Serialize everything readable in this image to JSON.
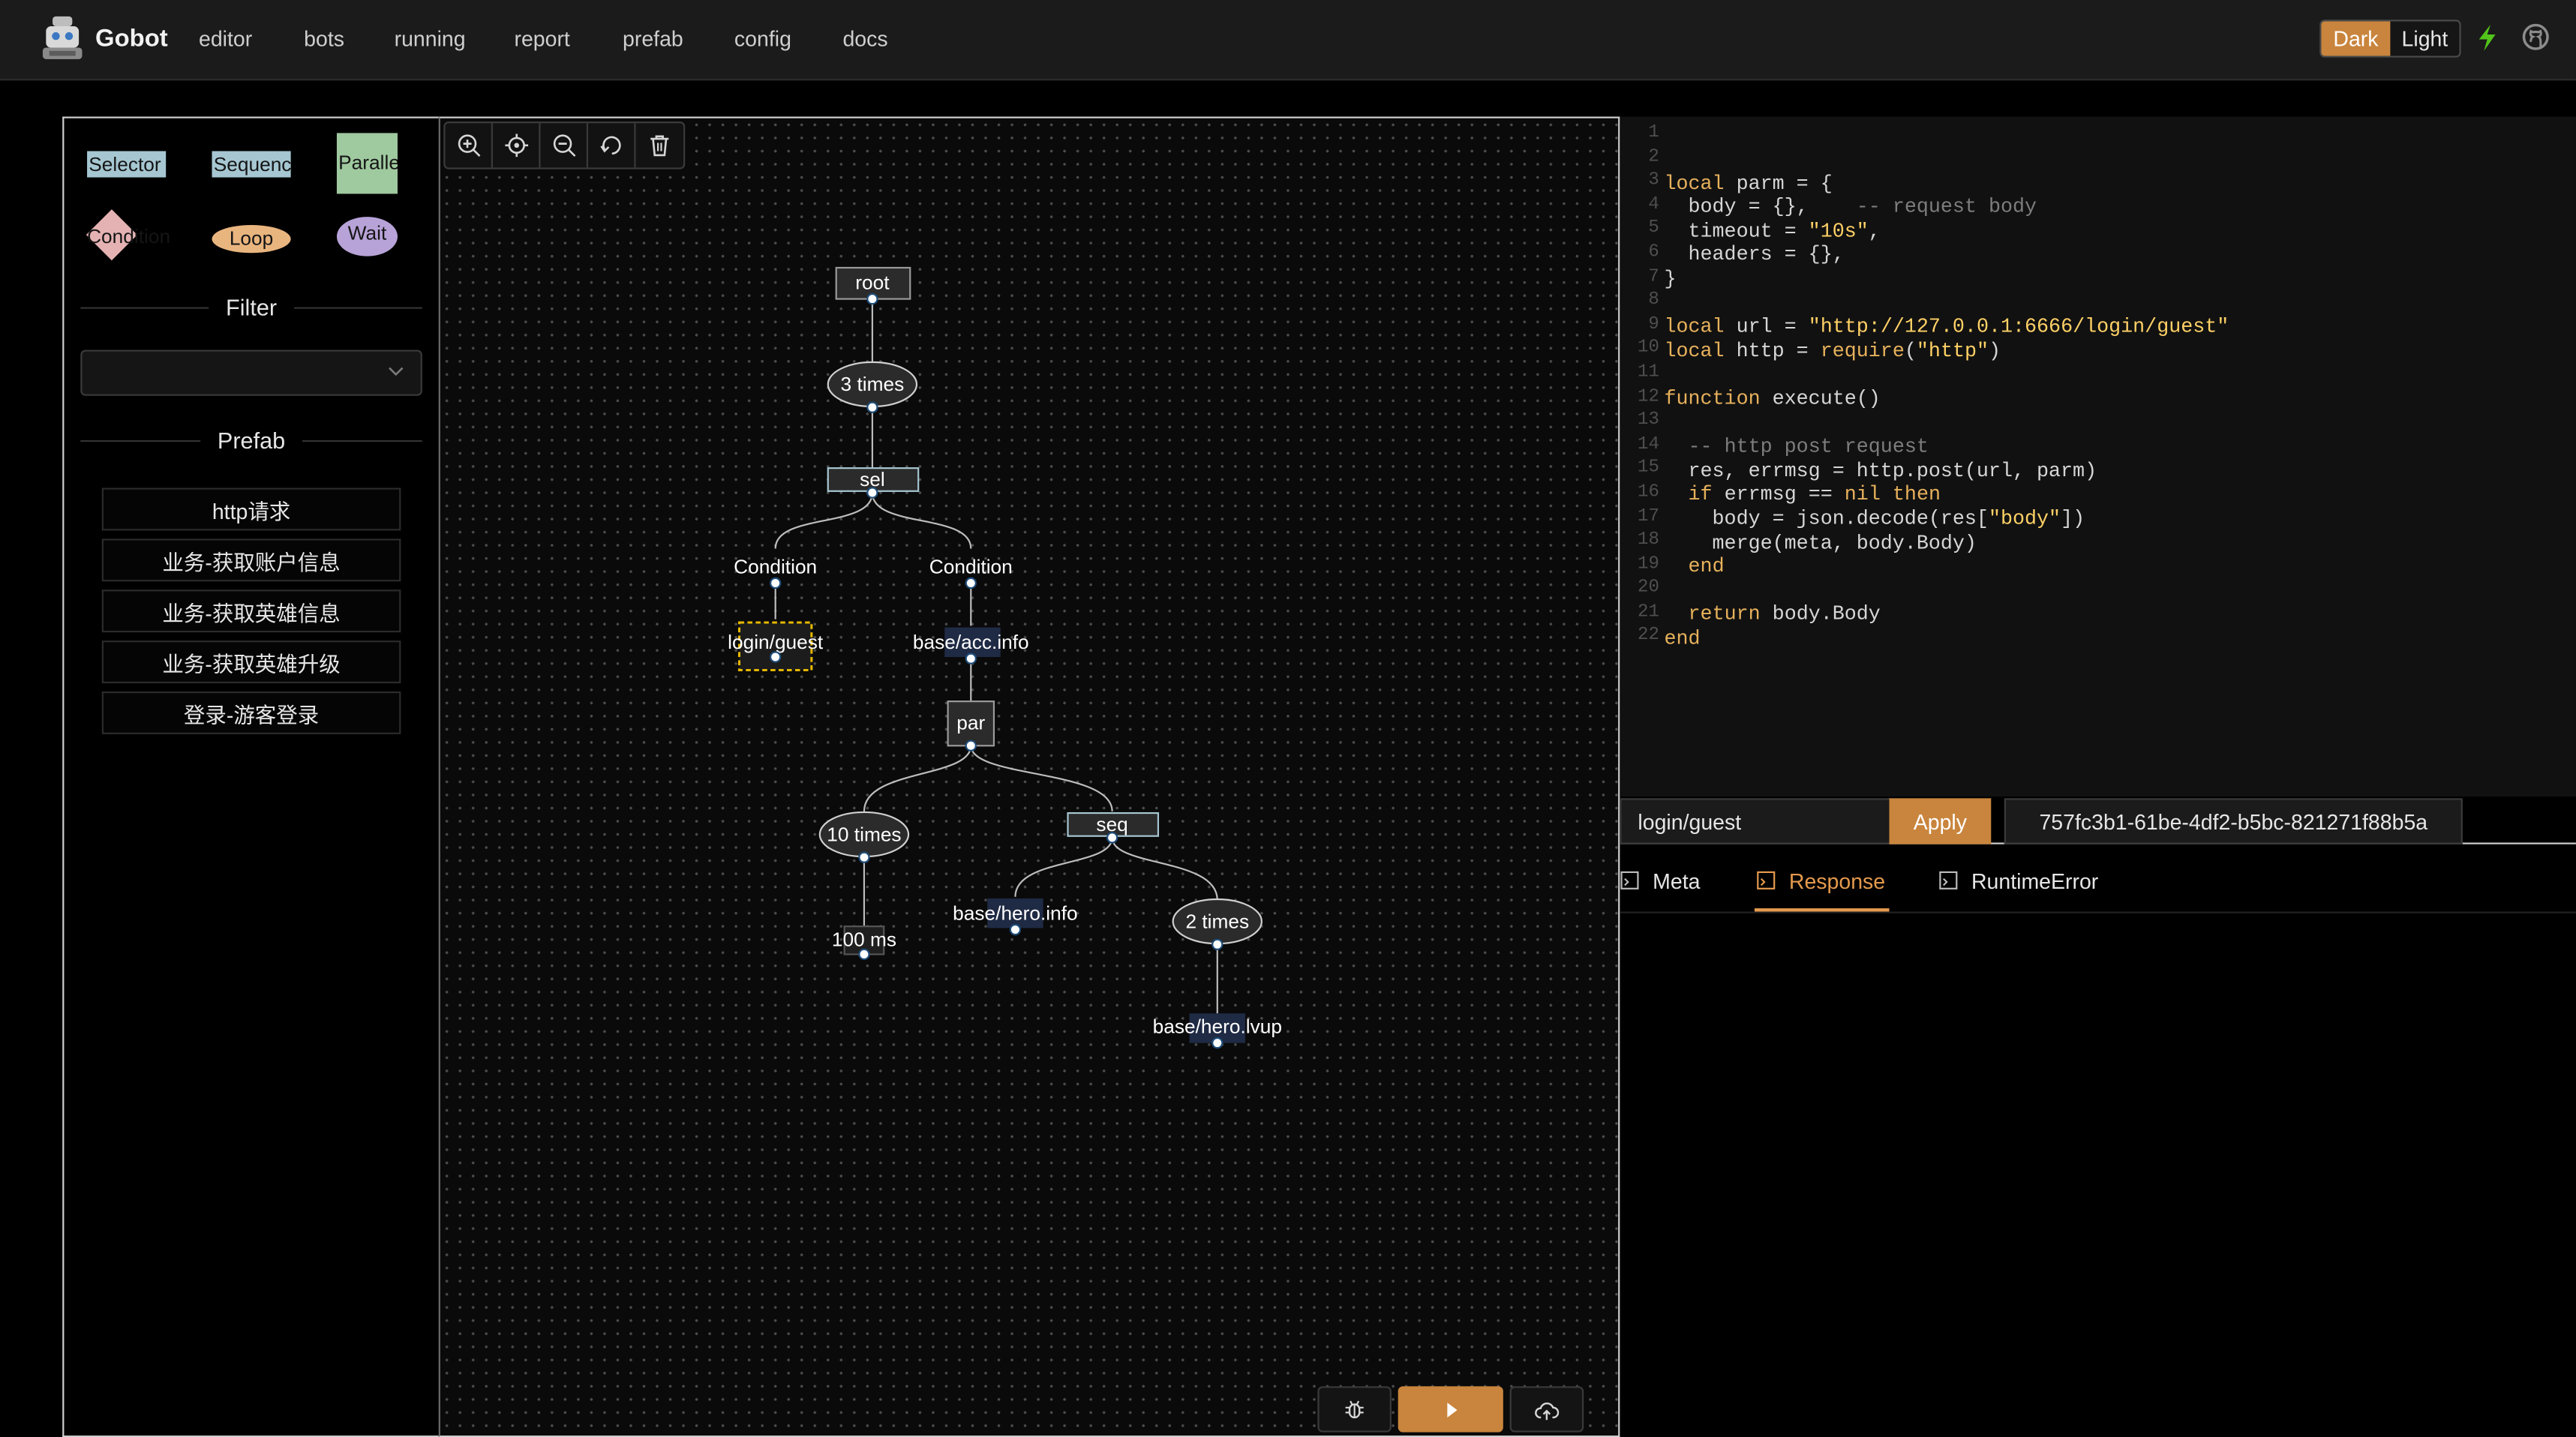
{
  "header": {
    "app_title": "Gobot",
    "nav": [
      "editor",
      "bots",
      "running",
      "report",
      "prefab",
      "config",
      "docs"
    ],
    "theme_dark": "Dark",
    "theme_light": "Light",
    "accent_color": "#c9853d"
  },
  "sidebar": {
    "node_types": {
      "selector": "Selector",
      "sequence": "Sequence",
      "parallel": "Parallel",
      "condition": "Condition",
      "loop": "Loop",
      "wait": "Wait"
    },
    "filter_title": "Filter",
    "filter_value": "",
    "prefab_title": "Prefab",
    "prefab_items": [
      "http请求",
      "业务-获取账户信息",
      "业务-获取英雄信息",
      "业务-获取英雄升级",
      "登录-游客登录"
    ]
  },
  "tree": {
    "nodes": {
      "root": "root",
      "loop3": "3 times",
      "sel": "sel",
      "cond1": "Condition",
      "cond2": "Condition",
      "login": "login/guest",
      "accinfo": "base/acc.info",
      "par": "par",
      "loop10": "10 times",
      "seq": "seq",
      "wait": "100 ms",
      "heroinfo": "base/hero.info",
      "loop2": "2 times",
      "herolvup": "base/hero.lvup"
    }
  },
  "editor": {
    "lines": [
      "",
      "local parm = {",
      "  body = {},    -- request body",
      "  timeout = \"10s\",",
      "  headers = {},",
      "}",
      "",
      "local url = \"http://127.0.0.1:6666/login/guest\"",
      "local http = require(\"http\")",
      "",
      "function execute()",
      "",
      "  -- http post request",
      "  res, errmsg = http.post(url, parm)",
      "  if errmsg == nil then",
      "    body = json.decode(res[\"body\"])",
      "    merge(meta, body.Body)",
      "  end",
      "",
      "  return body.Body",
      "end",
      ""
    ]
  },
  "panel": {
    "url_value": "login/guest",
    "apply_label": "Apply",
    "uuid": "757fc3b1-61be-4df2-b5bc-821271f88b5a",
    "tabs": [
      "Meta",
      "Response",
      "RuntimeError"
    ],
    "active_tab": "Response"
  }
}
